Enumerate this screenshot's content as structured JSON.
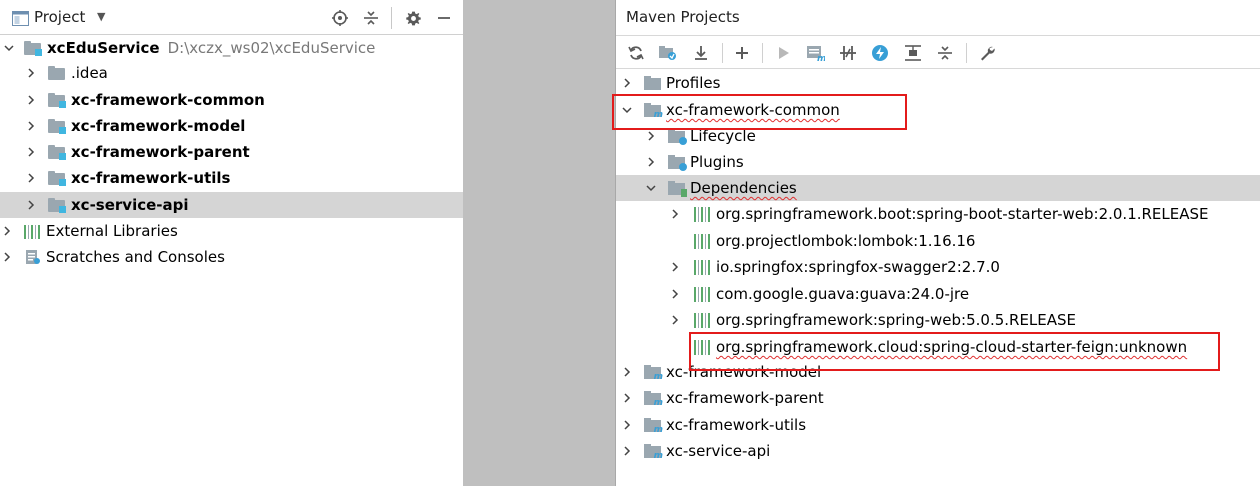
{
  "left_panel": {
    "title": "Project",
    "tree": [
      {
        "label": "xcEduService",
        "path": "D:\\xczx_ws02\\xcEduService",
        "bold": true,
        "expanded": true
      },
      {
        "label": ".idea",
        "bold": false
      },
      {
        "label": "xc-framework-common",
        "bold": true
      },
      {
        "label": "xc-framework-model",
        "bold": true
      },
      {
        "label": "xc-framework-parent",
        "bold": true
      },
      {
        "label": "xc-framework-utils",
        "bold": true
      },
      {
        "label": "xc-service-api",
        "bold": true,
        "selected": true
      },
      {
        "label": "External Libraries"
      },
      {
        "label": "Scratches and Consoles"
      }
    ]
  },
  "right_panel": {
    "title": "Maven Projects",
    "tree": [
      {
        "label": "Profiles"
      },
      {
        "label": "xc-framework-common",
        "expanded": true,
        "highlighted": true
      },
      {
        "label": "Lifecycle"
      },
      {
        "label": "Plugins"
      },
      {
        "label": "Dependencies",
        "expanded": true,
        "selected": true
      },
      {
        "label": "org.springframework.boot:spring-boot-starter-web:2.0.1.RELEASE"
      },
      {
        "label": "org.projectlombok:lombok:1.16.16"
      },
      {
        "label": "io.springfox:springfox-swagger2:2.7.0"
      },
      {
        "label": "com.google.guava:guava:24.0-jre"
      },
      {
        "label": "org.springframework:spring-web:5.0.5.RELEASE"
      },
      {
        "label": "org.springframework.cloud:spring-cloud-starter-feign:unknown",
        "highlighted": true
      },
      {
        "label": "xc-framework-model"
      },
      {
        "label": "xc-framework-parent"
      },
      {
        "label": "xc-framework-utils"
      },
      {
        "label": "xc-service-api"
      }
    ]
  },
  "colors": {
    "highlight_box": "#e31b1b",
    "selection": "#d5d5d5",
    "gap": "#bfbfbf",
    "library_green": "#59a869",
    "maven_blue": "#389fd6"
  }
}
